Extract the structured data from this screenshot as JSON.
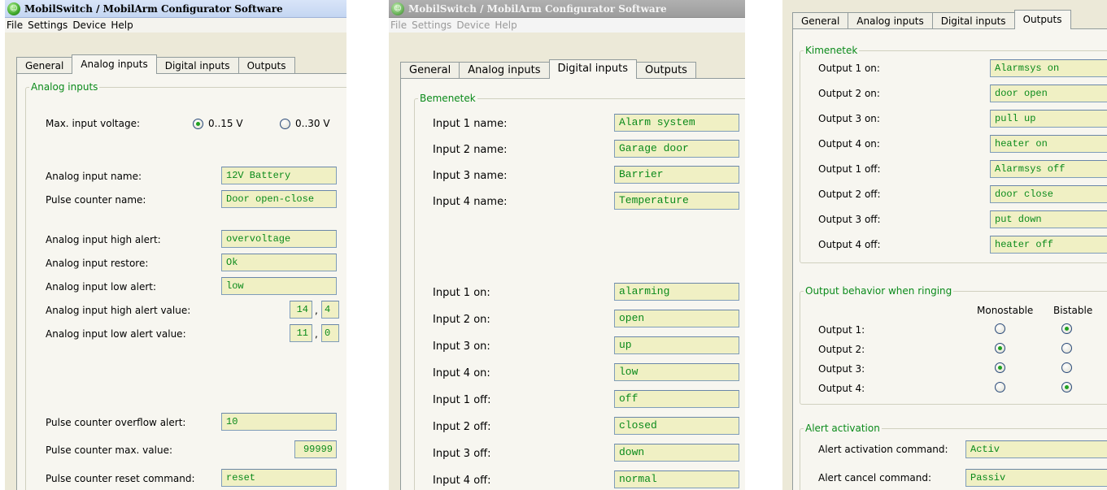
{
  "app": {
    "title": "MobilSwitch / MobilArm Configurator Software"
  },
  "menu": [
    "File",
    "Settings",
    "Device",
    "Help"
  ],
  "tabs": [
    "General",
    "Analog inputs",
    "Digital inputs",
    "Outputs"
  ],
  "analog": {
    "group": "Analog inputs",
    "max_voltage_label": "Max. input voltage:",
    "voltage_options": [
      "0..15 V",
      "0..30 V"
    ],
    "voltage_selected": "0..15 V",
    "analog_name_label": "Analog input name:",
    "analog_name": "12V Battery",
    "pulse_name_label": "Pulse counter name:",
    "pulse_name": "Door open-close",
    "high_alert_label": "Analog input high alert:",
    "high_alert": "overvoltage",
    "restore_label": "Analog input restore:",
    "restore": "Ok",
    "low_alert_label": "Analog input low alert:",
    "low_alert": "low",
    "high_value_label": "Analog input high alert value:",
    "high_value_int": "14",
    "high_value_dec": "4",
    "low_value_label": "Analog input low alert value:",
    "low_value_int": "11",
    "low_value_dec": "0",
    "decimal_sep": ",",
    "overflow_label": "Pulse counter overflow alert:",
    "overflow": "10",
    "max_value_label": "Pulse counter max. value:",
    "max_value": "99999",
    "reset_label": "Pulse counter reset command:",
    "reset": "reset"
  },
  "digital": {
    "group": "Bemenetek",
    "names": [
      {
        "label": "Input 1 name:",
        "value": "Alarm system"
      },
      {
        "label": "Input 2 name:",
        "value": "Garage door"
      },
      {
        "label": "Input 3 name:",
        "value": "Barrier"
      },
      {
        "label": "Input 4 name:",
        "value": "Temperature"
      }
    ],
    "states": [
      {
        "label": "Input 1 on:",
        "value": "alarming"
      },
      {
        "label": "Input 2 on:",
        "value": "open"
      },
      {
        "label": "Input 3 on:",
        "value": "up"
      },
      {
        "label": "Input 4 on:",
        "value": "low"
      },
      {
        "label": "Input 1 off:",
        "value": "off"
      },
      {
        "label": "Input 2 off:",
        "value": "closed"
      },
      {
        "label": "Input 3 off:",
        "value": "down"
      },
      {
        "label": "Input 4 off:",
        "value": "normal"
      }
    ]
  },
  "outputs": {
    "group": "Kimenetek",
    "items": [
      {
        "label": "Output 1 on:",
        "value": "Alarmsys on"
      },
      {
        "label": "Output 2 on:",
        "value": "door open"
      },
      {
        "label": "Output 3 on:",
        "value": "pull up"
      },
      {
        "label": "Output 4 on:",
        "value": "heater on"
      },
      {
        "label": "Output 1 off:",
        "value": "Alarmsys off"
      },
      {
        "label": "Output 2 off:",
        "value": "door close"
      },
      {
        "label": "Output 3 off:",
        "value": "put down"
      },
      {
        "label": "Output 4 off:",
        "value": "heater off"
      }
    ],
    "behavior_group": "Output behavior when ringing",
    "col_mono": "Monostable",
    "col_bi": "Bistable",
    "behavior": [
      {
        "label": "Output 1:",
        "mode": "Bistable"
      },
      {
        "label": "Output 2:",
        "mode": "Monostable"
      },
      {
        "label": "Output 3:",
        "mode": "Monostable"
      },
      {
        "label": "Output 4:",
        "mode": "Bistable"
      }
    ],
    "alert_group": "Alert activation",
    "activation_label": "Alert activation command:",
    "activation": "Activ",
    "cancel_label": "Alert cancel command:",
    "cancel": "Passiv"
  },
  "colors": {
    "field_bg": "#f0f0c4",
    "field_text": "#0a8a1a",
    "legend": "#0a8a1a"
  }
}
